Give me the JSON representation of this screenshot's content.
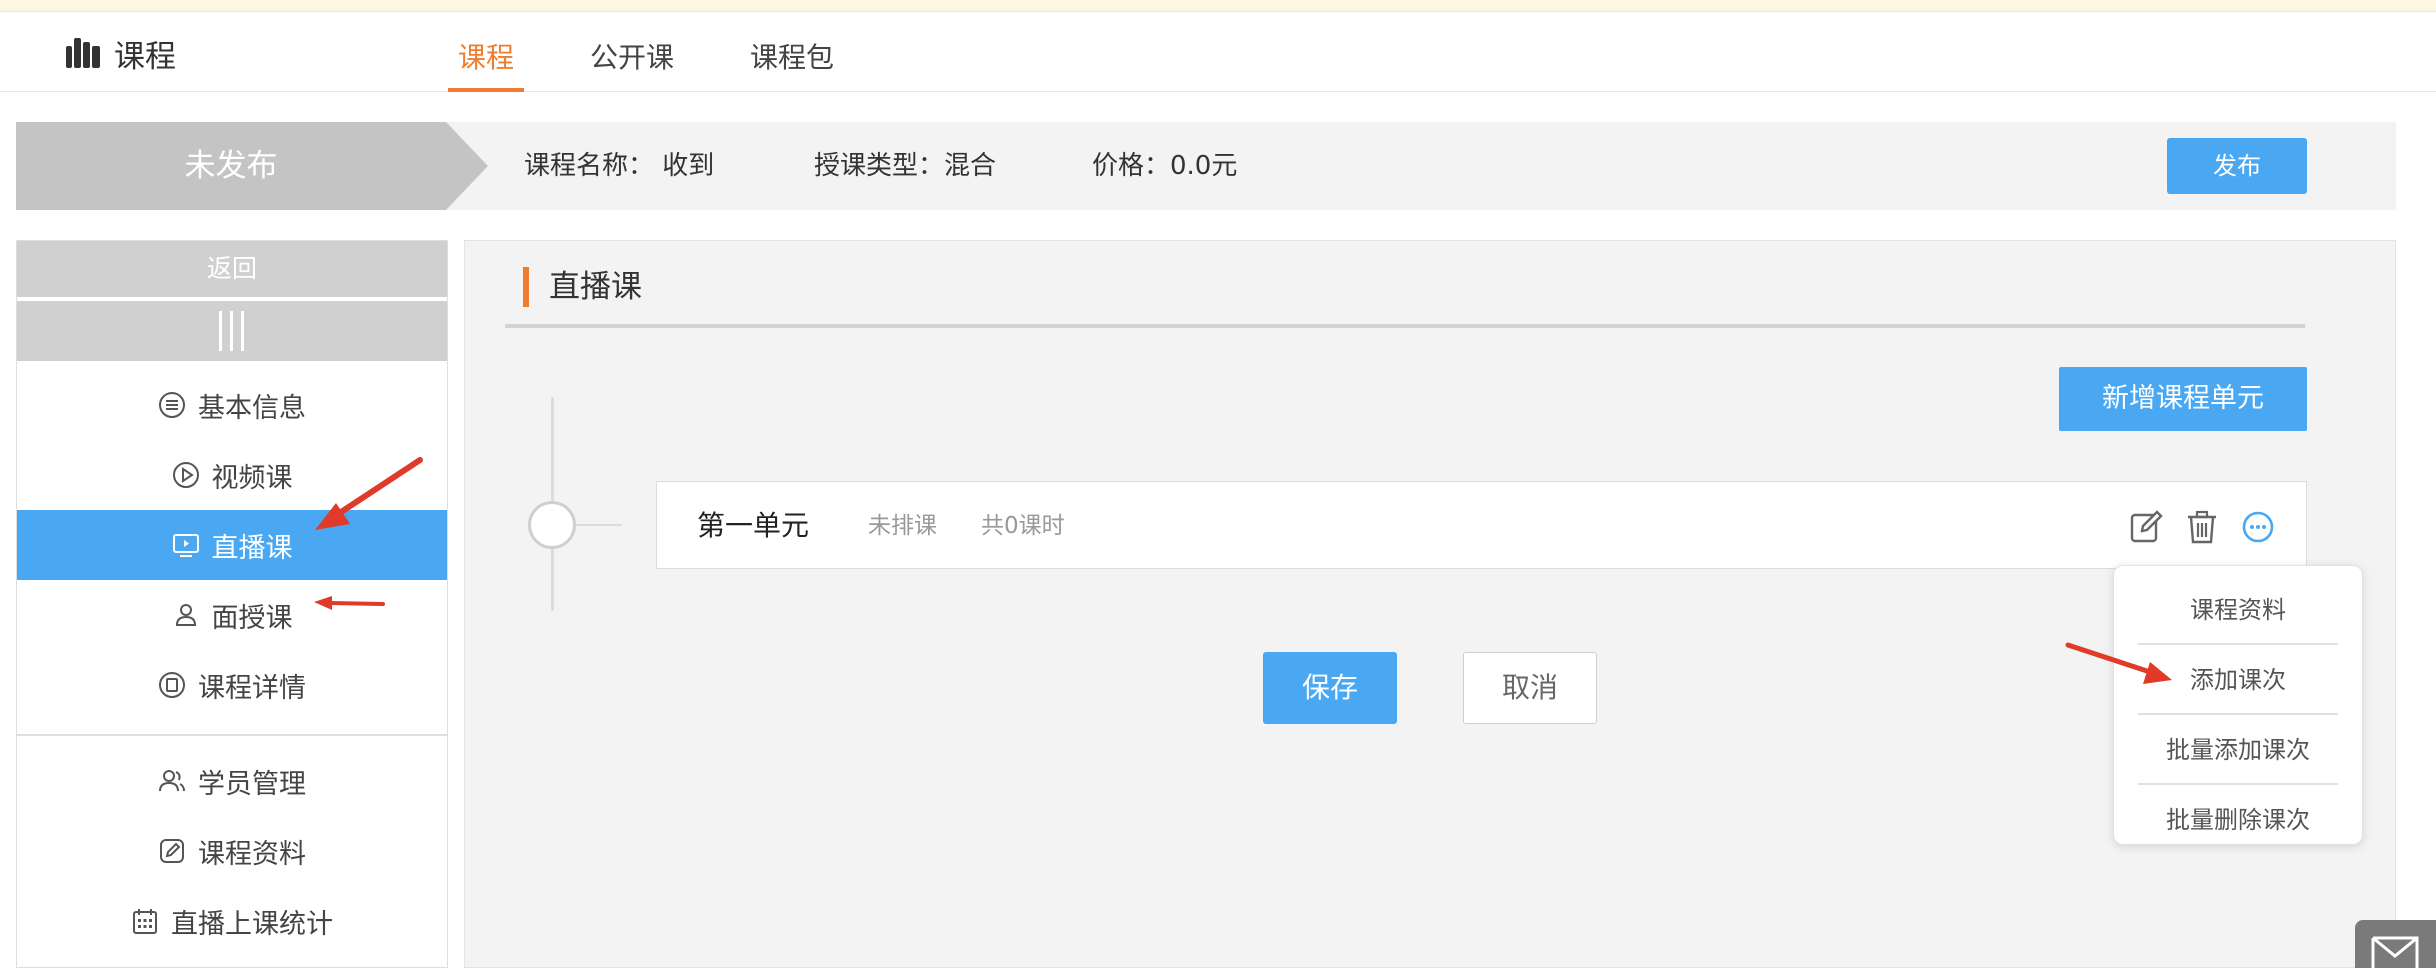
{
  "header": {
    "brand_title": "课程",
    "tabs": [
      {
        "label": "课程",
        "active": true
      },
      {
        "label": "公开课",
        "active": false
      },
      {
        "label": "课程包",
        "active": false
      }
    ]
  },
  "status": {
    "state": "未发布",
    "course_name": "课程名称：  收到",
    "teach_type": "授课类型：混合",
    "price": "价格：0.0元",
    "publish_label": "发布"
  },
  "sidebar": {
    "back_label": "返回",
    "items": [
      {
        "label": "基本信息",
        "icon": "list-circle-icon",
        "active": false
      },
      {
        "label": "视频课",
        "icon": "play-circle-icon",
        "active": false
      },
      {
        "label": "直播课",
        "icon": "tv-play-icon",
        "active": true
      },
      {
        "label": "面授课",
        "icon": "person-icon",
        "active": false
      },
      {
        "label": "课程详情",
        "icon": "detail-icon",
        "active": false
      },
      {
        "label": "学员管理",
        "icon": "users-icon",
        "active": false
      },
      {
        "label": "课程资料",
        "icon": "edit-doc-icon",
        "active": false
      },
      {
        "label": "直播上课统计",
        "icon": "calendar-icon",
        "active": false
      }
    ]
  },
  "main": {
    "section_title": "直播课",
    "add_unit_label": "新增课程单元",
    "unit": {
      "title": "第一单元",
      "status": "未排课",
      "count": "共0课时"
    },
    "save_label": "保存",
    "cancel_label": "取消"
  },
  "dropdown": {
    "items": [
      "课程资料",
      "添加课次",
      "批量添加课次",
      "批量删除课次"
    ]
  },
  "colors": {
    "accent_orange": "#f07d2e",
    "primary_blue": "#4aa8f3",
    "annotation_red": "#e03a2b"
  }
}
